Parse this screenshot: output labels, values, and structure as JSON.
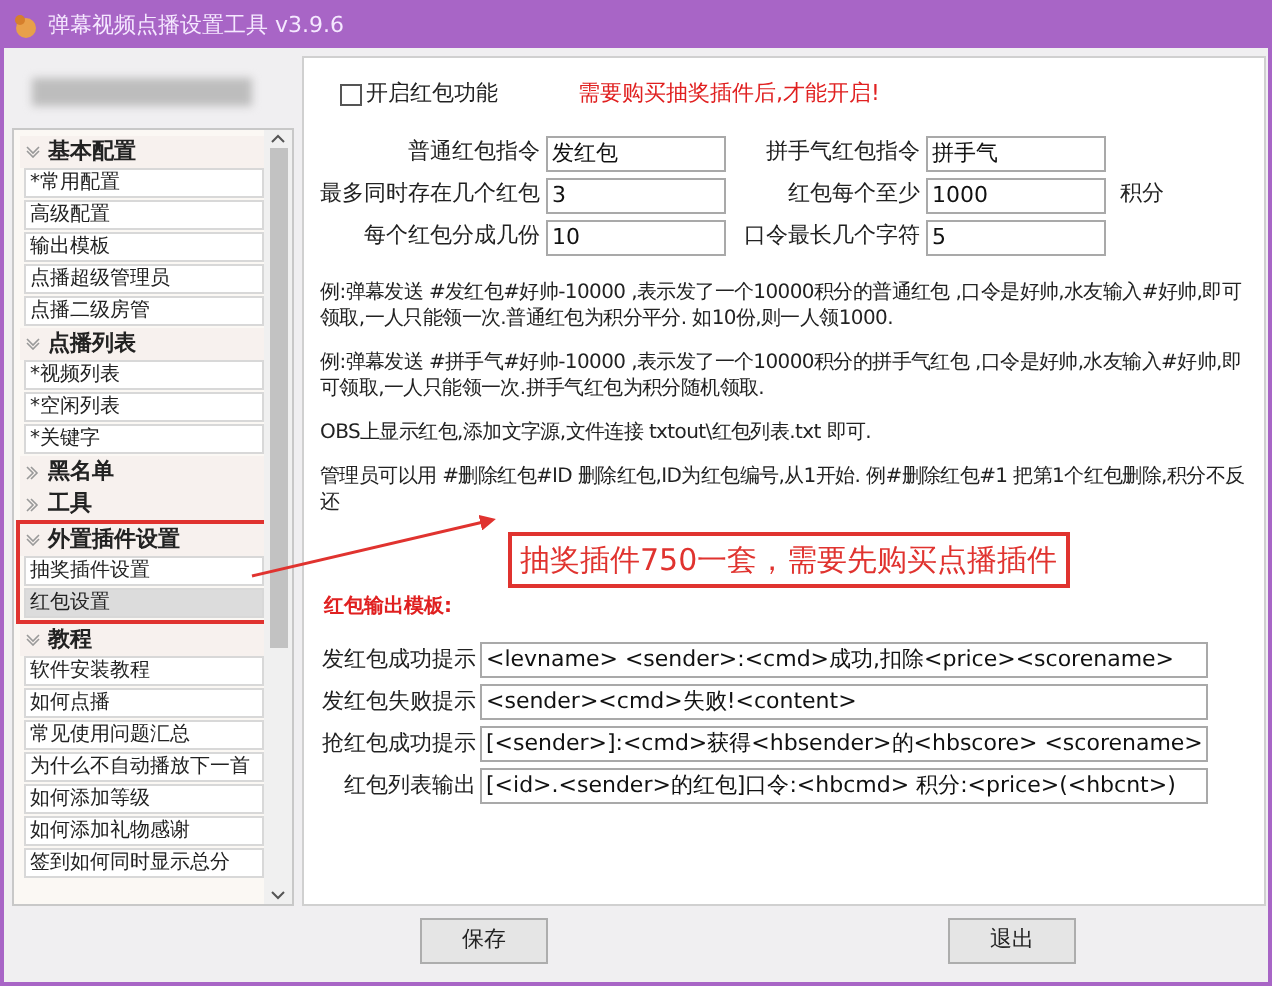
{
  "window": {
    "title": "弹幕视频点播设置工具 v3.9.6"
  },
  "sidebar": {
    "sections": [
      {
        "label": "基本配置",
        "expanded": true,
        "annotated": false,
        "items": [
          {
            "label": "*常用配置",
            "selected": false
          },
          {
            "label": "高级配置",
            "selected": false
          },
          {
            "label": "输出模板",
            "selected": false
          },
          {
            "label": "点播超级管理员",
            "selected": false
          },
          {
            "label": "点播二级房管",
            "selected": false
          }
        ]
      },
      {
        "label": "点播列表",
        "expanded": true,
        "annotated": false,
        "items": [
          {
            "label": "*视频列表",
            "selected": false
          },
          {
            "label": "*空闲列表",
            "selected": false
          },
          {
            "label": "*关键字",
            "selected": false
          }
        ]
      },
      {
        "label": "黑名单",
        "expanded": false,
        "annotated": false
      },
      {
        "label": "工具",
        "expanded": false,
        "annotated": false
      },
      {
        "label": "外置插件设置",
        "expanded": true,
        "annotated": true,
        "items": [
          {
            "label": "抽奖插件设置",
            "selected": false
          },
          {
            "label": "红包设置",
            "selected": true
          }
        ]
      },
      {
        "label": "教程",
        "expanded": true,
        "annotated": false,
        "items": [
          {
            "label": "软件安装教程",
            "selected": false
          },
          {
            "label": "如何点播",
            "selected": false
          },
          {
            "label": "常见使用问题汇总",
            "selected": false
          },
          {
            "label": "为什么不自动播放下一首",
            "selected": false
          },
          {
            "label": "如何添加等级",
            "selected": false
          },
          {
            "label": "如何添加礼物感谢",
            "selected": false
          },
          {
            "label": "签到如何同时显示总分",
            "selected": false
          }
        ]
      }
    ]
  },
  "main": {
    "enable_checkbox": {
      "label": "开启红包功能",
      "checked": false
    },
    "enable_note": "需要购买抽奖插件后,才能开启!",
    "fields": [
      {
        "label": "普通红包指令",
        "value": "发红包"
      },
      {
        "label": "拼手气红包指令",
        "value": "拼手气"
      },
      {
        "label": "最多同时存在几个红包",
        "value": "3"
      },
      {
        "label": "红包每个至少",
        "value": "1000",
        "unit": "积分"
      },
      {
        "label": "每个红包分成几份",
        "value": "10"
      },
      {
        "label": "口令最长几个字符",
        "value": "5"
      }
    ],
    "notes": [
      "例:弹幕发送 #发红包#好帅-10000 ,表示发了一个10000积分的普通红包 ,口令是好帅,水友输入#好帅,即可领取,一人只能领一次.普通红包为积分平分. 如10份,则一人领1000.",
      "例:弹幕发送 #拼手气#好帅-10000 ,表示发了一个10000积分的拼手气红包 ,口令是好帅,水友输入#好帅,即可领取,一人只能领一次.拼手气红包为积分随机领取.",
      "OBS上显示红包,添加文字源,文件连接 txtout\\红包列表.txt 即可.",
      "管理员可以用 #删除红包#ID 删除红包,ID为红包编号,从1开始. 例#删除红包#1 把第1个红包删除,积分不反还"
    ],
    "callout": "抽奖插件750一套，需要先购买点播插件",
    "template_heading": "红包输出模板:",
    "templates": [
      {
        "label": "发红包成功提示",
        "value": "<levname> <sender>:<cmd>成功,扣除<price><scorename>"
      },
      {
        "label": "发红包失败提示",
        "value": "<sender><cmd>失败!<content>"
      },
      {
        "label": "抢红包成功提示",
        "value": "[<sender>]:<cmd>获得<hbsender>的<hbscore> <scorename>"
      },
      {
        "label": "红包列表输出",
        "value": "[<id>.<sender>的红包]口令:<hbcmd> 积分:<price>(<hbcnt>)"
      }
    ]
  },
  "buttons": [
    "保存",
    "退出"
  ]
}
